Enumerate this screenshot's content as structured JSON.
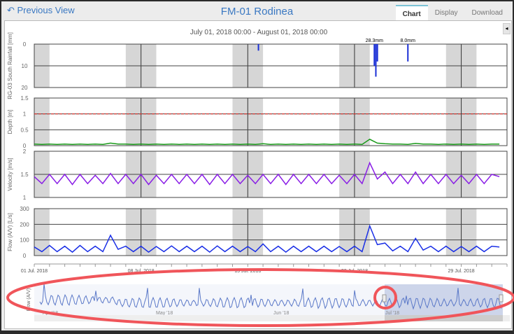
{
  "header": {
    "back_label": "Previous View",
    "title": "FM-01 Rodinea",
    "tabs": [
      {
        "label": "Chart",
        "active": true
      },
      {
        "label": "Display"
      },
      {
        "label": "Download"
      }
    ]
  },
  "chart": {
    "range_label": "July 01, 2018 00:00 - August 01, 2018 00:00"
  },
  "chart_data": [
    {
      "type": "bar",
      "ylabel": "RG-03 South Rainfall [mm]",
      "yticks": [
        "0",
        "10",
        "20"
      ],
      "ylim": [
        20,
        0
      ],
      "events": [
        {
          "day": 14.7,
          "mm": 3
        },
        {
          "day": 22.3,
          "mm": 10
        },
        {
          "day": 22.4,
          "mm": 15
        },
        {
          "day": 22.5,
          "mm": 8
        },
        {
          "day": 24.5,
          "mm": 8
        }
      ],
      "annotations": [
        "28.3mm",
        "8.0mm"
      ],
      "color": "#1a2fd6"
    },
    {
      "type": "line",
      "ylabel": "Depth [m]",
      "yticks": [
        "0",
        "0.5",
        "1",
        "1.5"
      ],
      "ylim": [
        0,
        1.5
      ],
      "threshold": 1.0,
      "threshold_color": "#e0302a",
      "color": "#1a9a1a",
      "values": [
        0.05,
        0.04,
        0.05,
        0.04,
        0.05,
        0.04,
        0.05,
        0.04,
        0.05,
        0.04,
        0.08,
        0.05,
        0.05,
        0.04,
        0.05,
        0.04,
        0.05,
        0.04,
        0.05,
        0.04,
        0.05,
        0.04,
        0.05,
        0.04,
        0.05,
        0.04,
        0.05,
        0.04,
        0.05,
        0.04,
        0.06,
        0.04,
        0.05,
        0.04,
        0.05,
        0.04,
        0.05,
        0.04,
        0.05,
        0.04,
        0.05,
        0.04,
        0.05,
        0.04,
        0.2,
        0.08,
        0.06,
        0.05,
        0.05,
        0.04,
        0.07,
        0.05,
        0.05,
        0.04,
        0.05,
        0.04,
        0.05,
        0.04,
        0.05,
        0.04,
        0.05,
        0.05
      ]
    },
    {
      "type": "line",
      "ylabel": "Velocity [m/s]",
      "yticks": [
        "1",
        "1.5",
        "2"
      ],
      "ylim": [
        1,
        2
      ],
      "color": "#8a1ee6",
      "values": [
        1.45,
        1.3,
        1.5,
        1.3,
        1.5,
        1.28,
        1.5,
        1.3,
        1.48,
        1.3,
        1.52,
        1.3,
        1.5,
        1.3,
        1.5,
        1.28,
        1.48,
        1.3,
        1.5,
        1.3,
        1.5,
        1.3,
        1.5,
        1.28,
        1.5,
        1.3,
        1.5,
        1.3,
        1.48,
        1.3,
        1.5,
        1.3,
        1.5,
        1.28,
        1.5,
        1.3,
        1.5,
        1.3,
        1.5,
        1.3,
        1.48,
        1.3,
        1.5,
        1.3,
        1.75,
        1.4,
        1.55,
        1.3,
        1.5,
        1.3,
        1.55,
        1.3,
        1.5,
        1.3,
        1.5,
        1.3,
        1.48,
        1.3,
        1.5,
        1.3,
        1.5,
        1.45
      ]
    },
    {
      "type": "line",
      "ylabel": "Flow (A/V) [L/s]",
      "yticks": [
        "0",
        "100",
        "200",
        "300"
      ],
      "ylim": [
        0,
        300
      ],
      "color": "#1a2fe6",
      "values": [
        55,
        25,
        65,
        25,
        60,
        22,
        65,
        25,
        60,
        25,
        130,
        40,
        60,
        25,
        60,
        22,
        58,
        25,
        62,
        25,
        60,
        25,
        60,
        22,
        62,
        25,
        60,
        25,
        58,
        25,
        75,
        25,
        60,
        22,
        60,
        25,
        60,
        25,
        60,
        25,
        58,
        25,
        60,
        25,
        190,
        70,
        80,
        30,
        60,
        25,
        110,
        35,
        60,
        25,
        60,
        25,
        58,
        25,
        60,
        25,
        60,
        55
      ]
    }
  ],
  "xaxis": {
    "ticks": [
      "01 Jul. 2018",
      "08 Jul. 2018",
      "15 Jul. 2018",
      "22 Jul. 2018",
      "29 Jul. 2018"
    ]
  },
  "navigator": {
    "series_label": "Flow (A/V)",
    "ticks": [
      "Apr '18",
      "May '18",
      "Jun '18",
      "Jul '18"
    ],
    "selected": "Jul '18"
  },
  "annotation_color": "#f0555a"
}
